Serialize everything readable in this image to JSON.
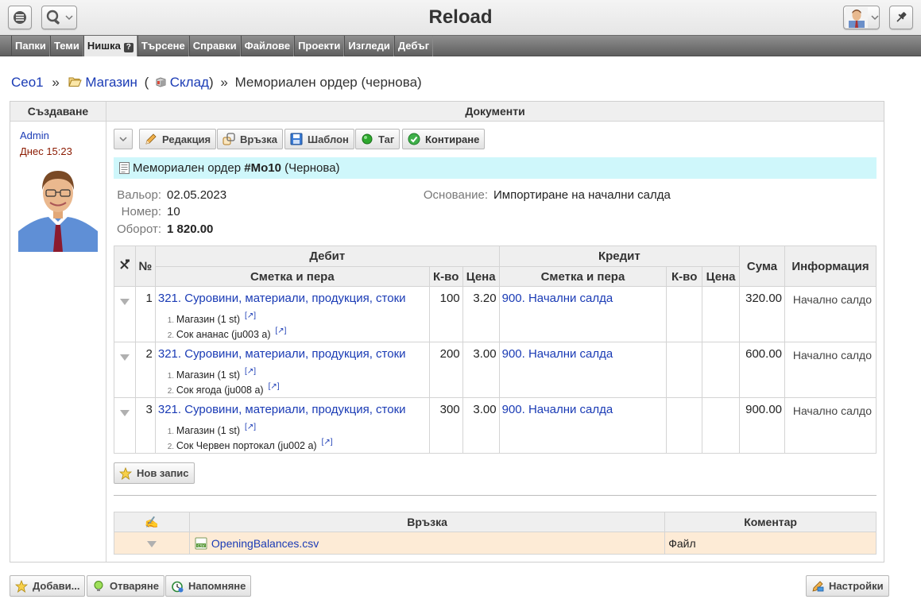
{
  "app": {
    "title": "Reload"
  },
  "menu": {
    "items": [
      "Папки",
      "Теми",
      "Нишка",
      "Търсене",
      "Справки",
      "Файлове",
      "Проекти",
      "Изгледи",
      "Дебъг"
    ],
    "help_mark": "?"
  },
  "breadcrumb": {
    "root": "Сео1",
    "sep": "»",
    "folder": "Магазин",
    "paren_open": "(",
    "store": "Склад",
    "paren_close": ")",
    "sep2": "»",
    "current": "Мемориален ордер (чернова)"
  },
  "frame": {
    "col_left_title": "Създаване",
    "col_right_title": "Документи"
  },
  "author": {
    "name": "Admin",
    "time": "Днес 15:23"
  },
  "toolbar": {
    "edit": "Редакция",
    "link": "Връзка",
    "template": "Шаблон",
    "tag": "Таг",
    "post": "Контиране"
  },
  "document": {
    "type_label": "Мемориален ордер",
    "number_label": "#Мо10",
    "status_label": "(Чернова)"
  },
  "fields": {
    "valor_label": "Вальор:",
    "valor_value": "02.05.2023",
    "number_label": "Номер:",
    "number_value": "10",
    "turnover_label": "Оборот:",
    "turnover_value": "1 820.00",
    "basis_label": "Основание:",
    "basis_value": "Импортиране на начални салда"
  },
  "entries": {
    "headers": {
      "no": "№",
      "debit": "Дебит",
      "credit": "Кредит",
      "account": "Сметка и пера",
      "qty": "К-во",
      "price": "Цена",
      "amount": "Сума",
      "info": "Информация"
    },
    "ext_link": "[↗]",
    "rows": [
      {
        "no": "1",
        "debit_account": "321. Суровини, материали, продукция, стоки",
        "item1": "Магазин (1 st)",
        "item2": "Сок ананас (ju003 a)",
        "qty": "100",
        "price": "3.20",
        "credit_account": "900. Начални салда",
        "amount": "320.00",
        "info": "Начално салдо"
      },
      {
        "no": "2",
        "debit_account": "321. Суровини, материали, продукция, стоки",
        "item1": "Магазин (1 st)",
        "item2": "Сок ягода (ju008 a)",
        "qty": "200",
        "price": "3.00",
        "credit_account": "900. Начални салда",
        "amount": "600.00",
        "info": "Начално салдо"
      },
      {
        "no": "3",
        "debit_account": "321. Суровини, материали, продукция, стоки",
        "item1": "Магазин (1 st)",
        "item2": "Сок Червен портокал (ju002 a)",
        "qty": "300",
        "price": "3.00",
        "credit_account": "900. Начални салда",
        "amount": "900.00",
        "info": "Начално салдо"
      }
    ]
  },
  "new_record": "Нов запис",
  "links_table": {
    "headers": {
      "icon": "✍",
      "link": "Връзка",
      "comment": "Коментар"
    },
    "rows": [
      {
        "file": "OpeningBalances.csv",
        "comment": "Файл"
      }
    ]
  },
  "bottom": {
    "add": "Добави...",
    "open": "Отваряне",
    "remind": "Напомняне",
    "settings": "Настройки"
  }
}
